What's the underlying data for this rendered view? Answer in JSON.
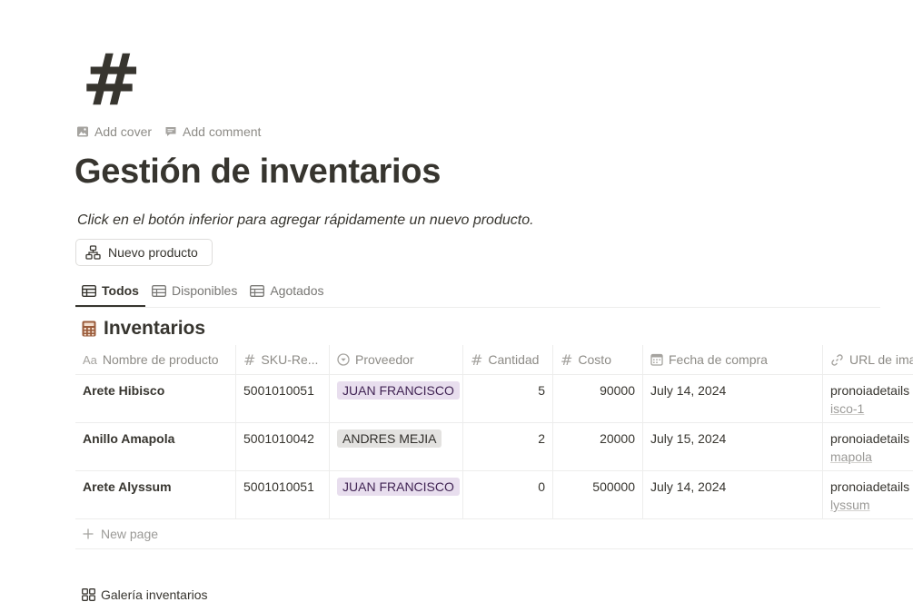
{
  "page": {
    "icon": "#",
    "add_cover": "Add cover",
    "add_comment": "Add comment",
    "title": "Gestión de inventarios",
    "description": "Click en el botón inferior para agregar rápidamente un nuevo producto.",
    "new_button": "Nuevo producto"
  },
  "tabs": [
    {
      "label": "Todos",
      "active": true
    },
    {
      "label": "Disponibles",
      "active": false
    },
    {
      "label": "Agotados",
      "active": false
    }
  ],
  "database": {
    "title": "Inventarios",
    "columns": [
      {
        "label": "Nombre de producto",
        "icon": "Aa"
      },
      {
        "label": "SKU-Re...",
        "icon": "#"
      },
      {
        "label": "Proveedor",
        "icon": "select-icon"
      },
      {
        "label": "Cantidad",
        "icon": "#"
      },
      {
        "label": "Costo",
        "icon": "#"
      },
      {
        "label": "Fecha de compra",
        "icon": "calendar-icon"
      },
      {
        "label": "URL de ima",
        "icon": "link-icon"
      }
    ],
    "rows": [
      {
        "name": "Arete Hibisco",
        "sku": "5001010051",
        "proveedor": "JUAN FRANCISCO",
        "cantidad": "5",
        "costo": "90000",
        "fecha": "July 14, 2024",
        "url_main": "pronoiadetails",
        "url_sub": "isco-1"
      },
      {
        "name": "Anillo Amapola",
        "sku": "5001010042",
        "proveedor": "ANDRES MEJIA",
        "cantidad": "2",
        "costo": "20000",
        "fecha": "July 15, 2024",
        "url_main": "pronoiadetails",
        "url_sub": "mapola"
      },
      {
        "name": "Arete Alyssum",
        "sku": "5001010051",
        "proveedor": "JUAN FRANCISCO",
        "cantidad": "0",
        "costo": "500000",
        "fecha": "July 14, 2024",
        "url_main": "pronoiadetails",
        "url_sub": "lyssum"
      }
    ],
    "new_page": "New page"
  },
  "gallery": {
    "title": "Galería inventarios"
  },
  "colors": {
    "tag_purple": "#e8deee",
    "tag_gray": "#e3e2e0",
    "text": "#37352f"
  }
}
